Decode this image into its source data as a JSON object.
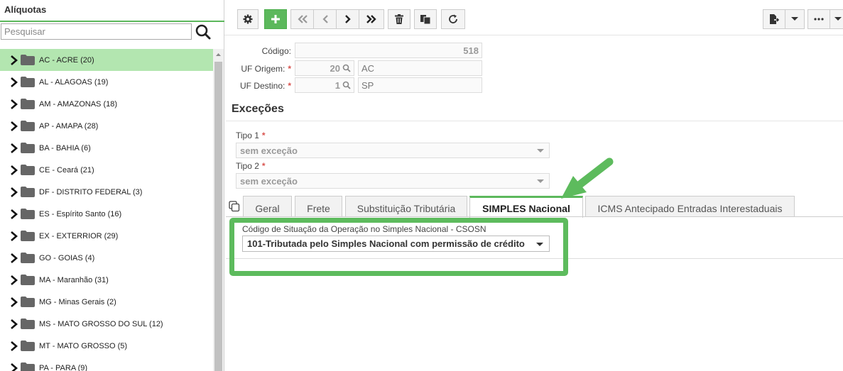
{
  "sidebar": {
    "title": "Alíquotas",
    "search_placeholder": "Pesquisar",
    "items": [
      {
        "label": "AC - ACRE (20)",
        "selected": true
      },
      {
        "label": "AL - ALAGOAS (19)"
      },
      {
        "label": "AM - AMAZONAS (18)"
      },
      {
        "label": "AP - AMAPA (28)"
      },
      {
        "label": "BA - BAHIA (6)"
      },
      {
        "label": "CE - Ceará (21)"
      },
      {
        "label": "DF - DISTRITO FEDERAL (3)"
      },
      {
        "label": "ES - Espírito Santo (16)"
      },
      {
        "label": "EX - EXTERRIOR (29)"
      },
      {
        "label": "GO - GOIAS (4)"
      },
      {
        "label": "MA - Maranhão (31)"
      },
      {
        "label": "MG - Minas Gerais (2)"
      },
      {
        "label": "MS - MATO GROSSO DO SUL (12)"
      },
      {
        "label": "MT - MATO GROSSO (5)"
      },
      {
        "label": "PA - PARA (9)"
      }
    ]
  },
  "toolbar": {
    "buttons": [
      "gear-icon",
      "plus-icon",
      "first-icon",
      "prev-icon",
      "next-icon",
      "last-icon",
      "trash-icon",
      "copy-icon",
      "refresh-icon"
    ],
    "right_buttons": [
      "export-icon",
      "caret-down-icon",
      "more-icon",
      "caret-down-icon"
    ]
  },
  "form": {
    "codigo_label": "Código:",
    "codigo_value": "518",
    "uf_origem_label": "UF Origem:",
    "uf_origem_code": "20",
    "uf_origem_name": "AC",
    "uf_destino_label": "UF Destino:",
    "uf_destino_code": "1",
    "uf_destino_name": "SP",
    "required_mark": "*"
  },
  "excecoes": {
    "title": "Exceções",
    "tipo1_label": "Tipo 1",
    "tipo1_value": "sem exceção",
    "tipo2_label": "Tipo 2",
    "tipo2_value": "sem exceção"
  },
  "tabs": [
    {
      "label": "Geral"
    },
    {
      "label": "Frete"
    },
    {
      "label": "Substituição Tributária"
    },
    {
      "label": "SIMPLES Nacional",
      "active": true
    },
    {
      "label": "ICMS Antecipado Entradas Interestaduais"
    }
  ],
  "simples": {
    "csosn_label": "Código de Situação da Operação no Simples Nacional - CSOSN",
    "csosn_value": "101-Tributada pelo Simples Nacional com permissão de crédito"
  },
  "colors": {
    "accent": "#5cb85c",
    "selected_row": "#b3e6b0",
    "highlight": "#5dbb5d",
    "required": "#d9534f"
  }
}
